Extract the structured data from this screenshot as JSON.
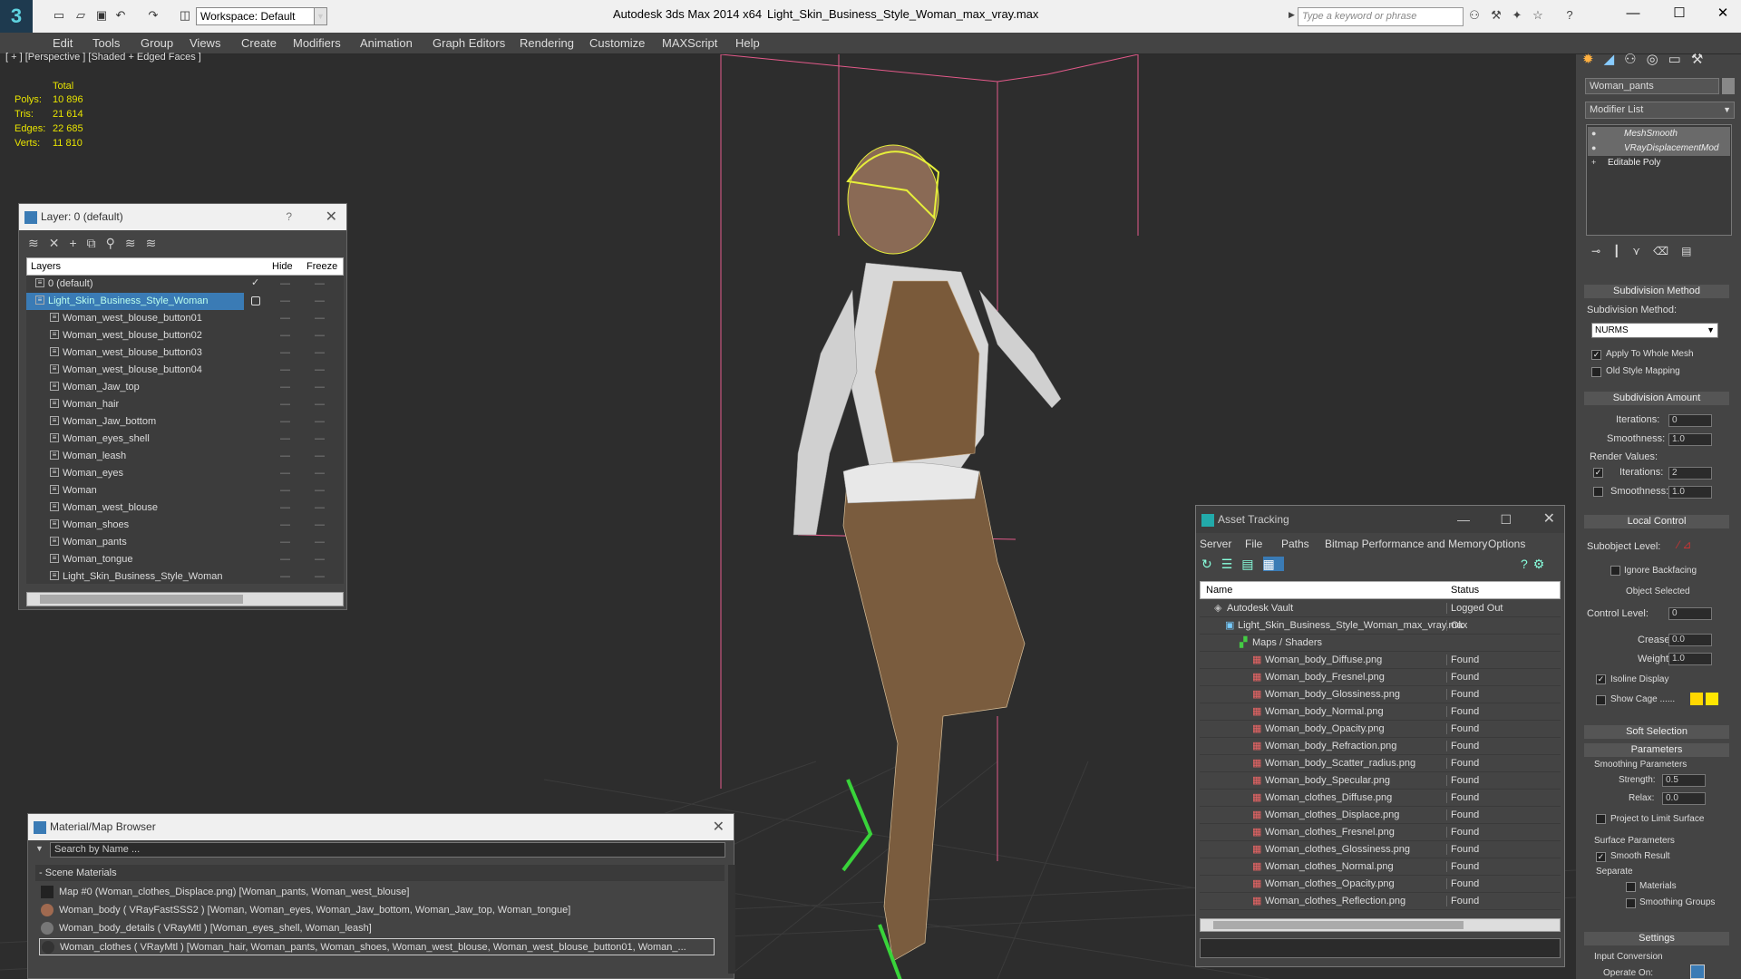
{
  "app": {
    "title": "Autodesk 3ds Max  2014 x64",
    "file": "Light_Skin_Business_Style_Woman_max_vray.max",
    "workspace": "Workspace: Default",
    "search_placeholder": "Type a keyword or phrase",
    "logo": "3"
  },
  "menu": [
    "Edit",
    "Tools",
    "Group",
    "Views",
    "Create",
    "Modifiers",
    "Animation",
    "Graph Editors",
    "Rendering",
    "Customize",
    "MAXScript",
    "Help"
  ],
  "viewport": {
    "label": "[ + ] [Perspective ] [Shaded + Edged Faces ]",
    "stats": {
      "header": "Total",
      "rows": [
        {
          "k": "Polys:",
          "v": "10 896"
        },
        {
          "k": "Tris:",
          "v": "21 614"
        },
        {
          "k": "Edges:",
          "v": "22 685"
        },
        {
          "k": "Verts:",
          "v": "11 810"
        }
      ]
    }
  },
  "layer": {
    "title": "Layer: 0 (default)",
    "help": "?",
    "cols": {
      "name": "Layers",
      "hide": "Hide",
      "freeze": "Freeze"
    },
    "rows": [
      "0 (default)",
      "Light_Skin_Business_Style_Woman",
      "Woman_west_blouse_button01",
      "Woman_west_blouse_button02",
      "Woman_west_blouse_button03",
      "Woman_west_blouse_button04",
      "Woman_Jaw_top",
      "Woman_hair",
      "Woman_Jaw_bottom",
      "Woman_eyes_shell",
      "Woman_leash",
      "Woman_eyes",
      "Woman",
      "Woman_west_blouse",
      "Woman_shoes",
      "Woman_pants",
      "Woman_tongue",
      "Light_Skin_Business_Style_Woman"
    ]
  },
  "material": {
    "title": "Material/Map Browser",
    "search": "Search by Name ...",
    "group": "Scene Materials",
    "rows": [
      "Map #0 (Woman_clothes_Displace.png) [Woman_pants, Woman_west_blouse]",
      "Woman_body  ( VRayFastSSS2 ) [Woman, Woman_eyes, Woman_Jaw_bottom, Woman_Jaw_top, Woman_tongue]",
      "Woman_body_details  ( VRayMtl ) [Woman_eyes_shell, Woman_leash]",
      "Woman_clothes  ( VRayMtl ) [Woman_hair, Woman_pants, Woman_shoes, Woman_west_blouse, Woman_west_blouse_button01, Woman_..."
    ]
  },
  "asset": {
    "title": "Asset Tracking",
    "menu": [
      "Server",
      "File",
      "Paths",
      "Bitmap Performance and Memory",
      "Options"
    ],
    "cols": {
      "name": "Name",
      "status": "Status"
    },
    "rows": [
      {
        "n": "Autodesk Vault",
        "s": "Logged Out"
      },
      {
        "n": "Light_Skin_Business_Style_Woman_max_vray.max",
        "s": "Ok"
      },
      {
        "n": "Maps / Shaders",
        "s": ""
      },
      {
        "n": "Woman_body_Diffuse.png",
        "s": "Found"
      },
      {
        "n": "Woman_body_Fresnel.png",
        "s": "Found"
      },
      {
        "n": "Woman_body_Glossiness.png",
        "s": "Found"
      },
      {
        "n": "Woman_body_Normal.png",
        "s": "Found"
      },
      {
        "n": "Woman_body_Opacity.png",
        "s": "Found"
      },
      {
        "n": "Woman_body_Refraction.png",
        "s": "Found"
      },
      {
        "n": "Woman_body_Scatter_radius.png",
        "s": "Found"
      },
      {
        "n": "Woman_body_Specular.png",
        "s": "Found"
      },
      {
        "n": "Woman_clothes_Diffuse.png",
        "s": "Found"
      },
      {
        "n": "Woman_clothes_Displace.png",
        "s": "Found"
      },
      {
        "n": "Woman_clothes_Fresnel.png",
        "s": "Found"
      },
      {
        "n": "Woman_clothes_Glossiness.png",
        "s": "Found"
      },
      {
        "n": "Woman_clothes_Normal.png",
        "s": "Found"
      },
      {
        "n": "Woman_clothes_Opacity.png",
        "s": "Found"
      },
      {
        "n": "Woman_clothes_Reflection.png",
        "s": "Found"
      }
    ]
  },
  "cmd": {
    "object": "Woman_pants",
    "modlist": "Modifier List",
    "stack": [
      "MeshSmooth",
      "VRayDisplacementMod",
      "Editable Poly"
    ],
    "subdiv_method_title": "Subdivision Method",
    "subdiv_method_label": "Subdivision Method:",
    "subdiv_method": "NURMS",
    "apply_whole": "Apply To Whole Mesh",
    "old_style": "Old Style Mapping",
    "subdiv_amount_title": "Subdivision Amount",
    "iterations_label": "Iterations:",
    "iterations": "0",
    "smoothness_label": "Smoothness:",
    "smoothness": "1.0",
    "render_values": "Render Values:",
    "r_iterations_label": "Iterations:",
    "r_iterations": "2",
    "r_smoothness_label": "Smoothness:",
    "r_smoothness": "1.0",
    "local_control_title": "Local Control",
    "subobject": "Subobject Level:",
    "ignore_backfacing": "Ignore Backfacing",
    "object_selected": "Object Selected",
    "control_level_label": "Control Level:",
    "control_level": "0",
    "crease_label": "Crease:",
    "crease": "0.0",
    "weight_label": "Weight:",
    "weight": "1.0",
    "isoline": "Isoline Display",
    "show_cage": "Show Cage ......",
    "soft_selection": "Soft Selection",
    "parameters": "Parameters",
    "smoothing_params": "Smoothing Parameters",
    "strength_label": "Strength:",
    "strength": "0.5",
    "relax_label": "Relax:",
    "relax": "0.0",
    "project": "Project to Limit Surface",
    "surface_params": "Surface Parameters",
    "smooth_result": "Smooth Result",
    "separate": "Separate",
    "materials": "Materials",
    "smoothing_groups": "Smoothing Groups",
    "settings": "Settings",
    "input_conversion": "Input Conversion",
    "operate_on": "Operate On:"
  },
  "colors": {
    "wire_selected": "#e6ef3a",
    "shoes": "#39d33a",
    "grid": "#4a4a4a",
    "bbox": "#e35a8a",
    "cage": "#ffd700"
  }
}
